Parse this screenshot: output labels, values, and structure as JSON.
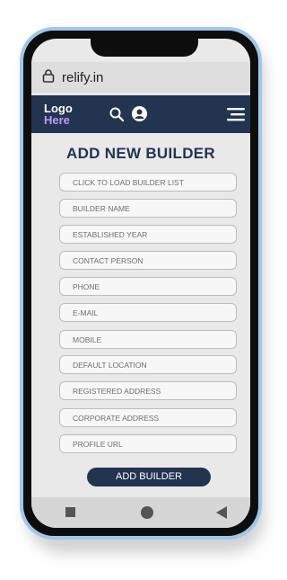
{
  "browser": {
    "url": "relify.in"
  },
  "header": {
    "logo_line1": "Logo",
    "logo_line2": "Here"
  },
  "form": {
    "title": "ADD NEW BUILDER",
    "fields": [
      "CLICK TO LOAD BUILDER LIST",
      "BUILDER NAME",
      "ESTABLISHED YEAR",
      "CONTACT PERSON",
      "PHONE",
      "E-MAIL",
      "MOBILE",
      "DEFAULT LOCATION",
      "REGISTERED ADDRESS",
      "CORPORATE ADDRESS",
      "PROFILE URL"
    ],
    "submit_label": "ADD BUILDER"
  },
  "colors": {
    "brand": "#223450",
    "logo_accent": "#b89cf5",
    "phone_frame": "#9ec7ea"
  },
  "icons": [
    "lock-icon",
    "search-icon",
    "user-icon",
    "menu-icon",
    "nav-square-icon",
    "nav-circle-icon",
    "nav-triangle-icon"
  ]
}
